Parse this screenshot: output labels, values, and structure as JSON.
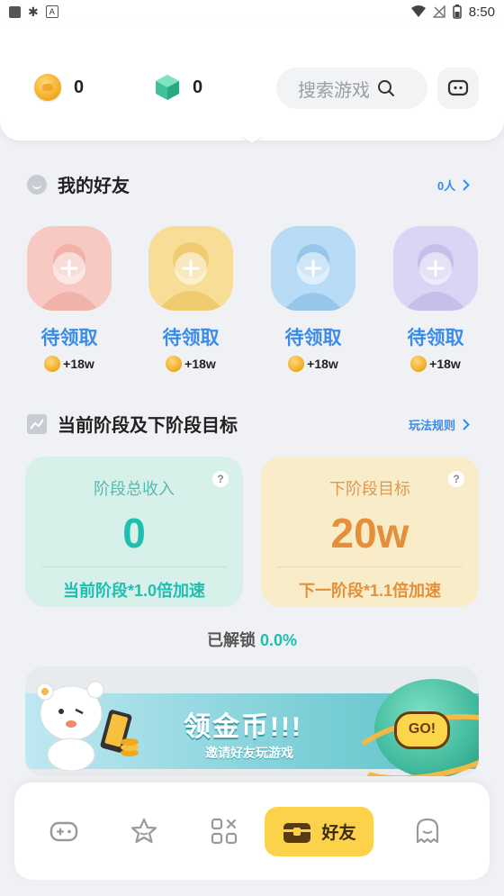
{
  "status_bar": {
    "time": "8:50"
  },
  "header": {
    "coins": "0",
    "gems": "0",
    "search_placeholder": "搜索游戏"
  },
  "friends_section": {
    "title": "我的好友",
    "count_link": "0人",
    "friends": [
      {
        "label": "待领取",
        "reward": "+18w",
        "bg": "#f7c9c2"
      },
      {
        "label": "待领取",
        "reward": "+18w",
        "bg": "#f8dd96"
      },
      {
        "label": "待领取",
        "reward": "+18w",
        "bg": "#b8dcf5"
      },
      {
        "label": "待领取",
        "reward": "+18w",
        "bg": "#d9d6f5"
      }
    ]
  },
  "stage_section": {
    "title": "当前阶段及下阶段目标",
    "rules_link": "玩法规则",
    "current": {
      "title": "阶段总收入",
      "value": "0",
      "foot": "当前阶段*1.0倍加速"
    },
    "next": {
      "title": "下阶段目标",
      "value": "20w",
      "foot": "下一阶段*1.1倍加速"
    },
    "unlocked_label": "已解锁",
    "unlocked_pct": "0.0%"
  },
  "banner": {
    "title": "领金币!!!",
    "subtitle": "邀请好友玩游戏",
    "go": "GO!"
  },
  "tabbar": {
    "active_label": "好友",
    "accent": "#fcd24a"
  },
  "colors": {
    "accent_blue": "#3b8be8",
    "teal": "#1fbfb0",
    "orange": "#e58f3a"
  }
}
